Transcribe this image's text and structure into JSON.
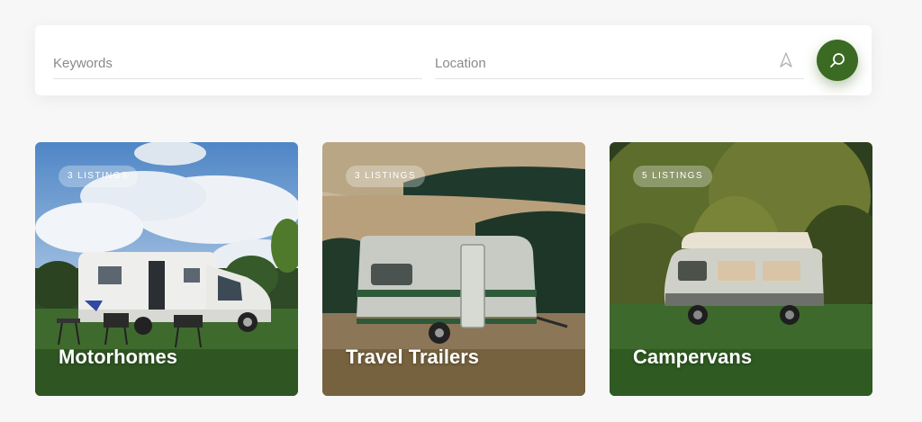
{
  "search": {
    "keywords_placeholder": "Keywords",
    "location_placeholder": "Location",
    "location_icon": "navigation-arrow-icon",
    "search_icon": "search-icon",
    "accent_color": "#3b6a22"
  },
  "categories": [
    {
      "title": "Motorhomes",
      "badge": "3 LISTINGS"
    },
    {
      "title": "Travel Trailers",
      "badge": "3 LISTINGS"
    },
    {
      "title": "Campervans",
      "badge": "5 LISTINGS"
    }
  ]
}
